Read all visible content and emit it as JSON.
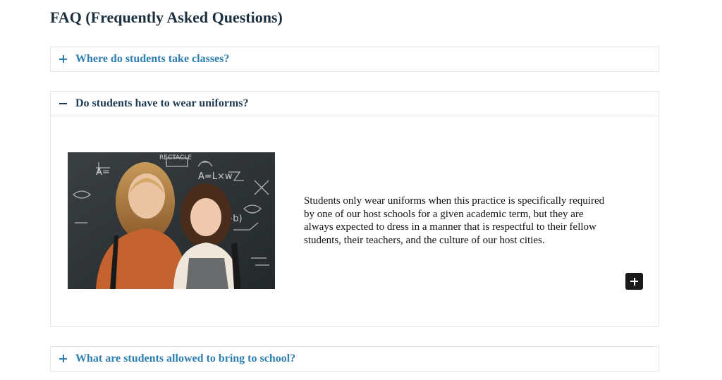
{
  "page": {
    "title": "FAQ (Frequently Asked Questions)"
  },
  "faq": [
    {
      "question": "Where do students take classes?",
      "state": "collapsed",
      "icon": "plus-icon"
    },
    {
      "question": "Do students have to wear uniforms?",
      "state": "expanded",
      "icon": "minus-icon",
      "answer": "Students only wear uniforms when this practice is specifically required by one of our host schools for a given academic term, but they are always expected to dress in a manner that is respectful to their fellow students, their teachers, and the culture of our host cities.",
      "image_description_icon": "photo-two-students-chalkboard",
      "expand_button_icon": "plus-icon"
    },
    {
      "question": "What are students allowed to bring to school?",
      "state": "collapsed",
      "icon": "plus-icon"
    }
  ],
  "colors": {
    "link_blue": "#2e7fb0",
    "active_navy": "#1c3a52",
    "title": "#1c2f3f",
    "border": "#e6e6e6"
  }
}
